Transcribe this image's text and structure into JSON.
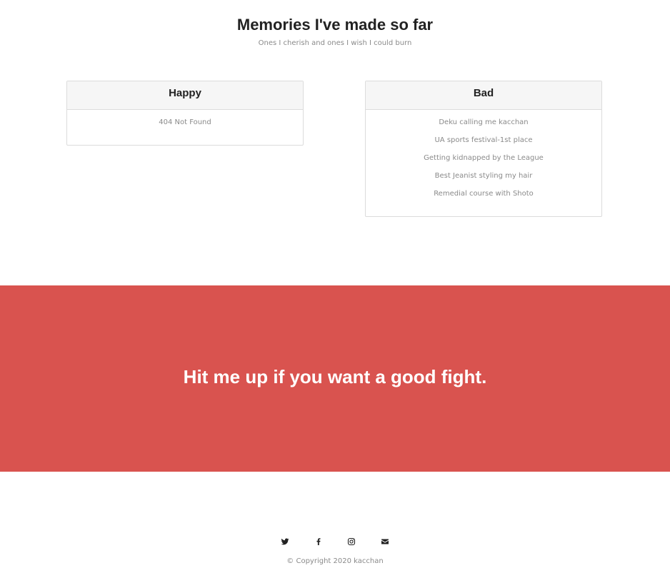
{
  "memories": {
    "title": "Memories I've made so far",
    "subtitle": "Ones I cherish and ones I wish I could burn"
  },
  "cards": {
    "happy": {
      "title": "Happy",
      "items": [
        "404 Not Found"
      ]
    },
    "bad": {
      "title": "Bad",
      "items": [
        "Deku calling me kacchan",
        "UA sports festival-1st place",
        "Getting kidnapped by the League",
        "Best Jeanist styling my hair",
        "Remedial course with Shoto"
      ]
    }
  },
  "banner": {
    "text": "Hit me up if you want a good fight.",
    "color": "#d9534f"
  },
  "footer": {
    "social_icons": [
      "twitter-icon",
      "facebook-icon",
      "instagram-icon",
      "envelope-icon"
    ],
    "copyright": "© Copyright 2020 kacchan"
  }
}
